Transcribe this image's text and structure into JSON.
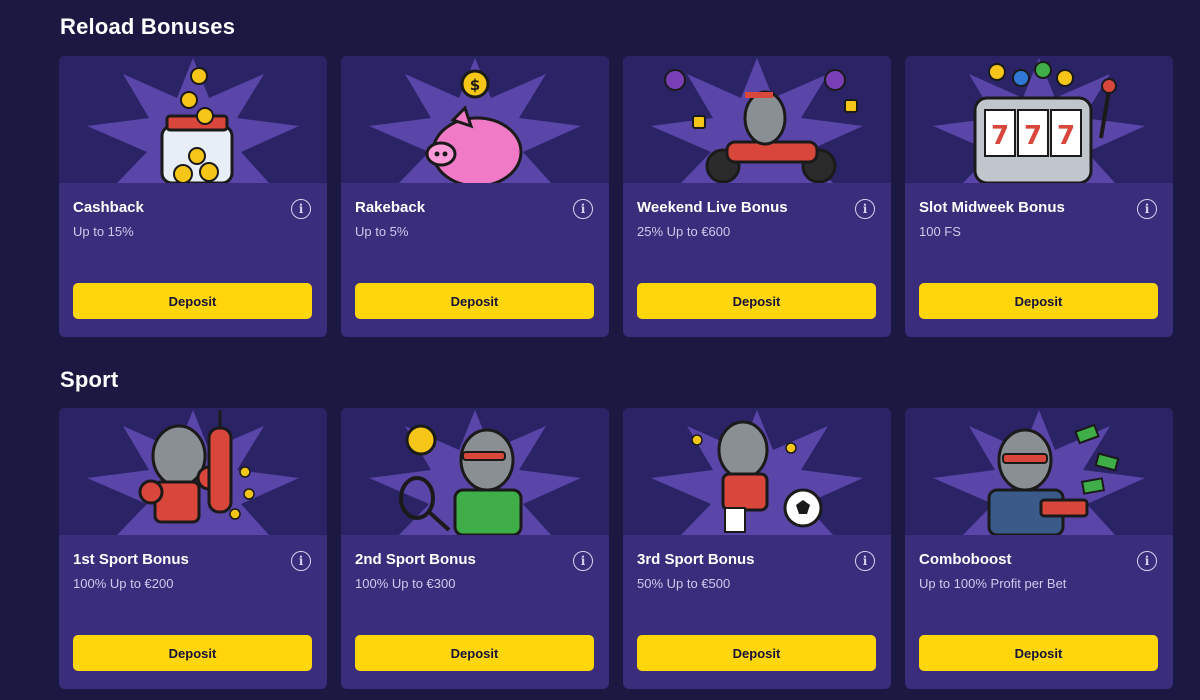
{
  "sections": [
    {
      "title": "Reload Bonuses",
      "cards": [
        {
          "title": "Cashback",
          "subtitle": "Up to 15%",
          "button": "Deposit",
          "art": "coin-jar-icon"
        },
        {
          "title": "Rakeback",
          "subtitle": "Up to 5%",
          "button": "Deposit",
          "art": "piggy-bank-icon"
        },
        {
          "title": "Weekend Live Bonus",
          "subtitle": "25% Up to €600",
          "button": "Deposit",
          "art": "rhino-motorcycle-icon"
        },
        {
          "title": "Slot Midweek Bonus",
          "subtitle": "100 FS",
          "button": "Deposit",
          "art": "slot-machine-777-icon"
        }
      ]
    },
    {
      "title": "Sport",
      "cards": [
        {
          "title": "1st Sport Bonus",
          "subtitle": "100% Up to €200",
          "button": "Deposit",
          "art": "rhino-boxer-icon"
        },
        {
          "title": "2nd Sport Bonus",
          "subtitle": "100% Up to €300",
          "button": "Deposit",
          "art": "rhino-tennis-icon"
        },
        {
          "title": "3rd Sport Bonus",
          "subtitle": "50% Up to €500",
          "button": "Deposit",
          "art": "rhino-soccer-icon"
        },
        {
          "title": "Comboboost",
          "subtitle": "Up to 100% Profit per Bet",
          "button": "Deposit",
          "art": "rhino-money-gun-icon"
        }
      ]
    }
  ],
  "colors": {
    "background": "#1b1942",
    "card": "#3a2d7b",
    "art_background": "#2a2466",
    "starburst": "#5a45a8",
    "button": "#ffd60a",
    "button_text": "#16133a",
    "subtitle": "#cfc9ec"
  },
  "info_glyph": "i"
}
